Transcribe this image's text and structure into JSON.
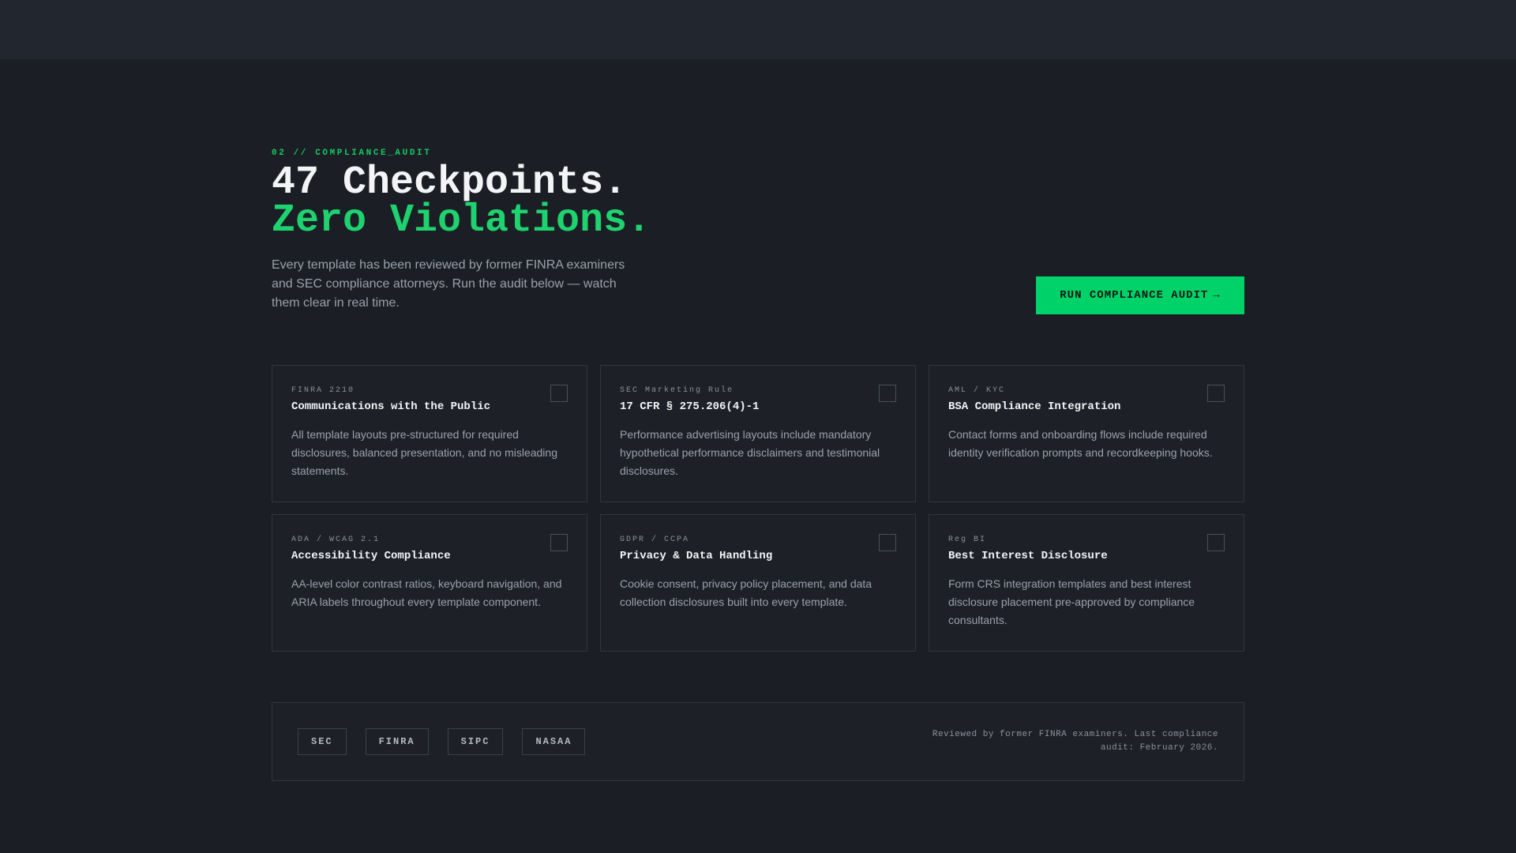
{
  "section": {
    "eyebrow": "02 // COMPLIANCE_AUDIT",
    "headline_line1": "47 Checkpoints.",
    "headline_line2": "Zero Violations.",
    "lead": "Every template has been reviewed by former FINRA examiners and SEC compliance attorneys. Run the audit below — watch them clear in real time.",
    "cta_label": "RUN COMPLIANCE AUDIT",
    "cta_arrow": "→"
  },
  "checkpoints": [
    {
      "tag": "FINRA 2210",
      "title": "Communications with the Public",
      "description": "All template layouts pre-structured for required disclosures, balanced presentation, and no misleading statements.",
      "checked": false
    },
    {
      "tag": "SEC Marketing Rule",
      "title": "17 CFR § 275.206(4)-1",
      "description": "Performance advertising layouts include mandatory hypothetical performance disclaimers and testimonial disclosures.",
      "checked": false
    },
    {
      "tag": "AML / KYC",
      "title": "BSA Compliance Integration",
      "description": "Contact forms and onboarding flows include required identity verification prompts and recordkeeping hooks.",
      "checked": false
    },
    {
      "tag": "ADA / WCAG 2.1",
      "title": "Accessibility Compliance",
      "description": "AA-level color contrast ratios, keyboard navigation, and ARIA labels throughout every template component.",
      "checked": false
    },
    {
      "tag": "GDPR / CCPA",
      "title": "Privacy & Data Handling",
      "description": "Cookie consent, privacy policy placement, and data collection disclosures built into every template.",
      "checked": false
    },
    {
      "tag": "Reg BI",
      "title": "Best Interest Disclosure",
      "description": "Form CRS integration templates and best interest disclosure placement pre-approved by compliance consultants.",
      "checked": false
    }
  ],
  "footer": {
    "badges": [
      "SEC",
      "FINRA",
      "SIPC",
      "NASAA"
    ],
    "note": "Reviewed by former FINRA examiners. Last compliance audit: February 2026."
  },
  "colors": {
    "background": "#1b1e24",
    "topbar": "#22262e",
    "accent": "#00d26a",
    "accent_text": "#1ed36f",
    "card_border": "#31353d"
  }
}
